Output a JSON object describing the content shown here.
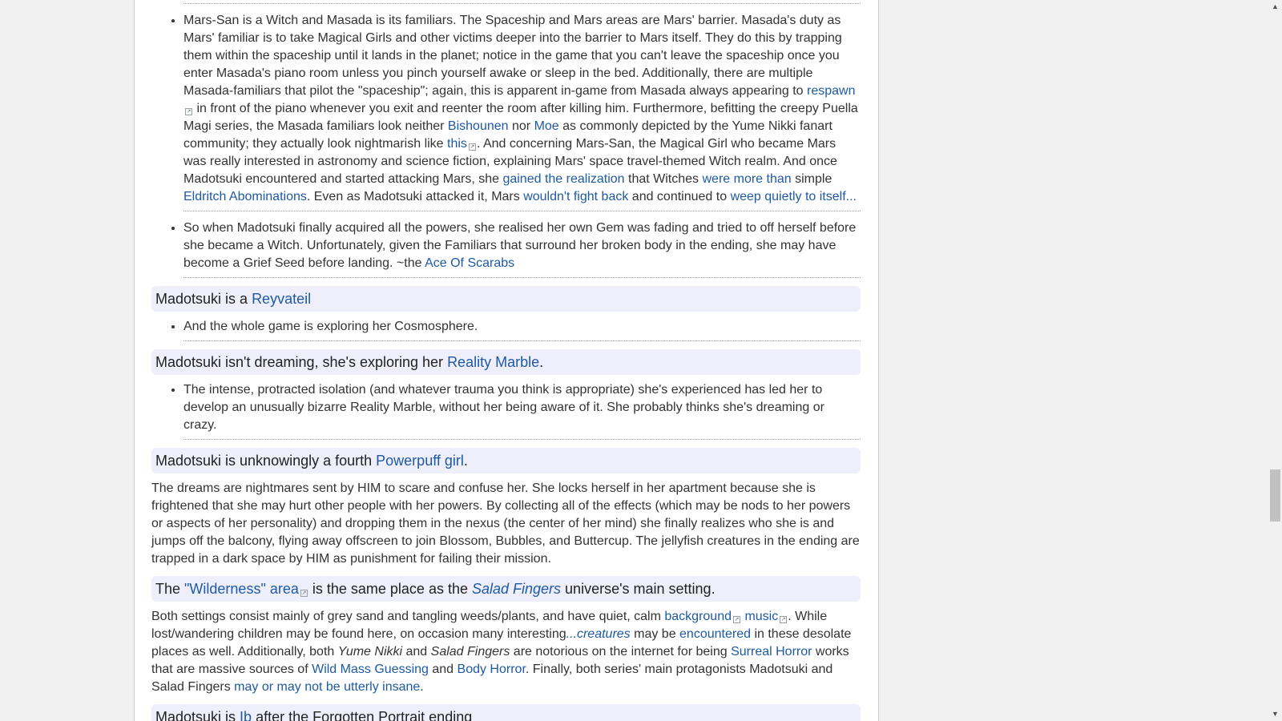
{
  "sections": [
    {
      "type": "bullets",
      "items": [
        [
          {
            "t": "Mars-San is a Witch and Masada is its familiars. The Spaceship and Mars areas are Mars' barrier. Masada's duty as Mars' familiar is to take Magical Girls and other victims deeper into the barrier to Mars itself. They do this by trapping them within the spaceship until it lands in the planet; notice in the game that you can't leave the spaceship once you enter Masada's piano room unless you pinch yourself awake or sleep in the bed. Additionally, there are multiple Masada-familiars that pilot the \"spaceship\"; again, this is apparent in-game from Masada always appearing to "
          },
          {
            "t": "respawn",
            "link": true,
            "ext": true
          },
          {
            "t": " in front of the piano whenever you exit and reenter the room after killing him. Furthermore, befitting the creepy Puella Magi series, the Masada familiars look neither "
          },
          {
            "t": "Bishounen",
            "link": true
          },
          {
            "t": " nor "
          },
          {
            "t": "Moe",
            "link": true
          },
          {
            "t": " as commonly depicted by the Yume Nikki fanart community; they actually look nightmarish like "
          },
          {
            "t": "this",
            "link": true,
            "ext": true
          },
          {
            "t": ". And concerning Mars-San, the Magical Girl who became Mars was really interested in astronomy and science fiction, explaining Mars' space travel-themed Witch realm. And once Madotsuki encountered and started attacking Mars, she "
          },
          {
            "t": "gained the realization",
            "link": true
          },
          {
            "t": " that Witches "
          },
          {
            "t": "were more than",
            "link": true
          },
          {
            "t": " simple "
          },
          {
            "t": "Eldritch Abominations",
            "link": true
          },
          {
            "t": ". Even as Madotsuki attacked it, Mars "
          },
          {
            "t": "wouldn't fight back",
            "link": true
          },
          {
            "t": " and continued to "
          },
          {
            "t": "weep quietly to itself...",
            "link": true
          }
        ],
        [
          {
            "t": "So when Madotsuki finally acquired all the powers, she realised her own Gem was fading and tried to off herself before she became a Witch. Unfortunately, given the Familiars that surround her broken body in the ending, she may have become a Grief Seed before landing. ~the "
          },
          {
            "t": "Ace Of Scarabs",
            "link": true
          }
        ]
      ]
    },
    {
      "type": "label",
      "parts": [
        {
          "t": "Madotsuki is a "
        },
        {
          "t": "Reyvateil",
          "link": true
        }
      ]
    },
    {
      "type": "bullets",
      "items": [
        [
          {
            "t": "And the whole game is exploring her Cosmosphere."
          }
        ]
      ]
    },
    {
      "type": "label",
      "parts": [
        {
          "t": "Madotsuki isn't dreaming, she's exploring her "
        },
        {
          "t": "Reality Marble",
          "link": true
        },
        {
          "t": "."
        }
      ]
    },
    {
      "type": "bullets",
      "items": [
        [
          {
            "t": "The intense, protracted isolation (and whatever trauma you think is appropriate) she's experienced has led her to develop an unusually bizarre Reality Marble, without her being aware of it. She probably thinks she's dreaming or crazy."
          }
        ]
      ]
    },
    {
      "type": "label",
      "parts": [
        {
          "t": "Madotsuki is unknowingly a fourth "
        },
        {
          "t": "Powerpuff girl",
          "link": true
        },
        {
          "t": "."
        }
      ]
    },
    {
      "type": "para",
      "parts": [
        {
          "t": "The dreams are nightmares sent by HIM to scare and confuse her. She locks herself in her apartment because she is frightened that she may hurt other people with her powers. By collecting all of the effects (which may be nods to her powers or aspects of her personality) and dropping them in the nexus (the center of her mind) she finally realizes who she is and jumps off the balcony, flying away offscreen to join Blossom, Bubbles, and Buttercup. The jellyfish creatures in the ending are trapped in a dark space by HIM as punishment for failing their mission."
        }
      ]
    },
    {
      "type": "label",
      "parts": [
        {
          "t": "The "
        },
        {
          "t": "\"Wilderness\" area",
          "link": true,
          "ext": true
        },
        {
          "t": " is the same place as the "
        },
        {
          "t": "Salad Fingers",
          "link": true,
          "italic": true
        },
        {
          "t": " universe's main setting."
        }
      ]
    },
    {
      "type": "para",
      "parts": [
        {
          "t": "Both settings consist mainly of grey sand and tangling weeds/plants, and have quiet, calm "
        },
        {
          "t": "background",
          "link": true,
          "ext": true
        },
        {
          "t": " "
        },
        {
          "t": "music",
          "link": true,
          "ext": true
        },
        {
          "t": ". While lost/wandering children may be found here, on occasion many interesting"
        },
        {
          "t": "...creatures",
          "link": true,
          "italic": true
        },
        {
          "t": " may be "
        },
        {
          "t": "encountered",
          "link": true
        },
        {
          "t": " in these desolate places as well. Additionally, both "
        },
        {
          "t": "Yume Nikki",
          "italic": true
        },
        {
          "t": " and "
        },
        {
          "t": "Salad Fingers",
          "italic": true
        },
        {
          "t": " are notorious on the internet for being "
        },
        {
          "t": "Surreal Horror",
          "link": true
        },
        {
          "t": " works that are massive sources of "
        },
        {
          "t": "Wild Mass Guessing",
          "link": true
        },
        {
          "t": " and "
        },
        {
          "t": "Body Horror",
          "link": true
        },
        {
          "t": ". Finally, both series' main protagonists Madotsuki and Salad Fingers "
        },
        {
          "t": "may or may not be utterly insane",
          "link": true
        },
        {
          "t": "."
        }
      ]
    },
    {
      "type": "label",
      "parts": [
        {
          "t": "Madotsuki is "
        },
        {
          "t": "Ib",
          "link": true
        },
        {
          "t": " after the Forgotten Portrait ending"
        }
      ]
    }
  ],
  "external_link_icon": "external-link-icon",
  "scrollbar": {
    "up_icon": "up-arrow-icon",
    "down_icon": "down-arrow-icon",
    "thumb_position": 0.71,
    "thumb_fraction": 0.075
  }
}
